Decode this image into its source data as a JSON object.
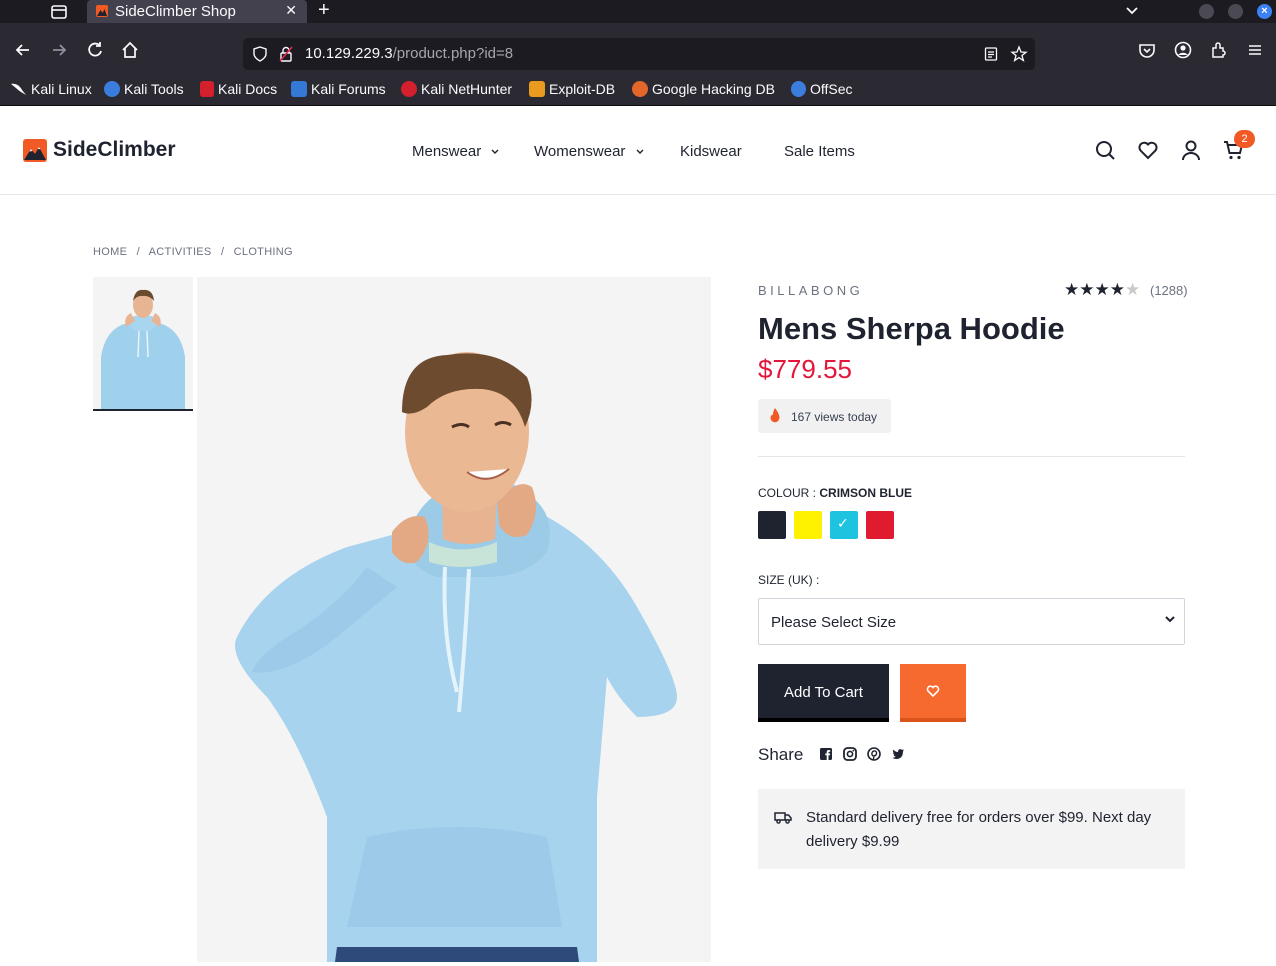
{
  "browser": {
    "tab_title": "SideClimber Shop",
    "url_host": "10.129.229.3",
    "url_path": "/product.php?id=8",
    "bookmarks": [
      "Kali Linux",
      "Kali Tools",
      "Kali Docs",
      "Kali Forums",
      "Kali NetHunter",
      "Exploit-DB",
      "Google Hacking DB",
      "OffSec"
    ]
  },
  "site": {
    "logo_text": "SideClimber",
    "nav": [
      "Menswear",
      "Womenswear",
      "Kidswear",
      "Sale Items"
    ],
    "cart_count": "2",
    "accent": "#f15a24"
  },
  "breadcrumb": [
    "HOME",
    "/",
    "ACTIVITIES",
    "/",
    "CLOTHING"
  ],
  "product": {
    "brand": "BILLABONG",
    "rating": 4,
    "rating_max": 5,
    "reviews": "(1288)",
    "title": "Mens Sherpa Hoodie",
    "price": "$779.55",
    "views": "167 views today",
    "colour_label": "COLOUR :",
    "colour_value": "CRIMSON BLUE",
    "swatches": [
      "#1f2330",
      "#fff200",
      "#1ec3e0",
      "#e01b2f"
    ],
    "size_label": "SIZE (UK) :",
    "size_value": "Please Select Size",
    "add_to_cart": "Add To Cart",
    "share_label": "Share",
    "delivery_text": "Standard delivery free for orders over $99. Next day delivery $9.99"
  }
}
